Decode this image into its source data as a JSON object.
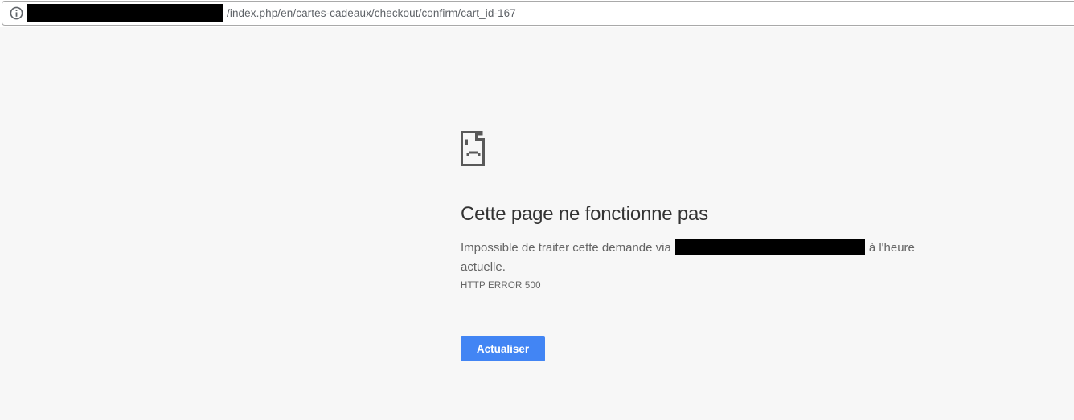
{
  "browser": {
    "address_bar": {
      "info_icon": "info-icon",
      "domain_redacted": true,
      "path_text": "/index.php/en/cartes-cadeaux/checkout/confirm/cart_id-167"
    }
  },
  "error_page": {
    "icon": "sad-page-icon",
    "title": "Cette page ne fonctionne pas",
    "message": {
      "prefix": "Impossible de traiter cette demande via",
      "redacted_target": true,
      "suffix": "à l'heure actuelle."
    },
    "error_code": "HTTP ERROR 500",
    "actions": {
      "reload_label": "Actualiser"
    }
  },
  "colors": {
    "accent_blue": "#4285f4",
    "page_background": "#f7f7f7",
    "heading_text": "#333333",
    "body_text": "#646464",
    "icon_gray": "#595959",
    "omnibox_border": "#a9a9a9",
    "redaction": "#000000",
    "button_text": "#ffffff"
  }
}
